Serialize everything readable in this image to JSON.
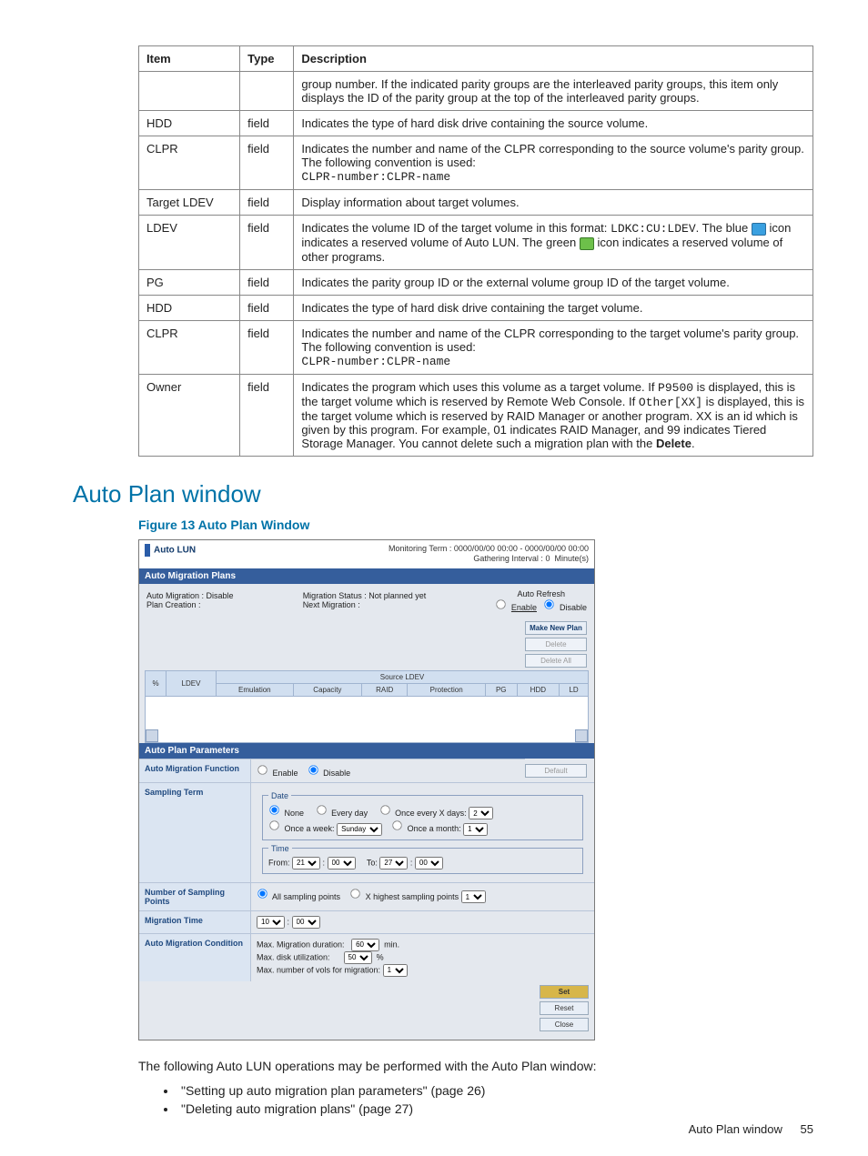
{
  "table": {
    "headers": {
      "item": "Item",
      "type": "Type",
      "desc": "Description"
    },
    "rows": [
      {
        "item": "",
        "type": "",
        "desc_html": "group number. If the indicated parity groups are the interleaved parity groups, this item only displays the ID of the parity group at the top of the interleaved parity groups."
      },
      {
        "item": "HDD",
        "type": "field",
        "desc_html": "Indicates the type of hard disk drive containing the source volume."
      },
      {
        "item": "CLPR",
        "type": "field",
        "desc_html": "Indicates the number and name of the CLPR corresponding to the source volume's parity group. The following convention is used:<br><span class='mono'>CLPR-number:CLPR-name</span>"
      },
      {
        "item": "Target LDEV",
        "type": "field",
        "desc_html": "Display information about target volumes."
      },
      {
        "item": "LDEV",
        "type": "field",
        "desc_html": "Indicates the volume ID of the target volume in this format: <span class='mono'>LDKC:CU:LDEV</span>. The blue <span class='blue-icon' data-name='reserved-autolun-icon' data-interactable='false'></span> icon indicates a reserved volume of Auto LUN. The green <span class='green-icon' data-name='reserved-other-icon' data-interactable='false'></span> icon indicates a reserved volume of other programs."
      },
      {
        "item": "PG",
        "type": "field",
        "desc_html": "Indicates the parity group ID or the external volume group ID of the target volume."
      },
      {
        "item": "HDD",
        "type": "field",
        "desc_html": "Indicates the type of hard disk drive containing the target volume."
      },
      {
        "item": "CLPR",
        "type": "field",
        "desc_html": "Indicates the number and name of the CLPR corresponding to the target volume's parity group. The following convention is used:<br><span class='mono'>CLPR-number:CLPR-name</span>"
      },
      {
        "item": "Owner",
        "type": "field",
        "desc_html": "Indicates the program which uses this volume as a target volume. If <span class='mono'>P9500</span> is displayed, this is the target volume which is reserved by Remote Web Console. If <span class='mono'>Other[XX]</span> is displayed, this is the target volume which is reserved by RAID Manager or another program. XX is an id which is given by this program. For example, 01 indicates RAID Manager, and 99 indicates Tiered Storage Manager. You cannot delete such a migration plan with the <b>Delete</b>."
      }
    ]
  },
  "section_title": "Auto Plan window",
  "figure_caption": "Figure 13 Auto Plan Window",
  "shot": {
    "app_title": "Auto LUN",
    "monitoring_term_label": "Monitoring Term :",
    "monitoring_term_value": "0000/00/00 00:00  -  0000/00/00 00:00",
    "gathering_label": "Gathering Interval :",
    "gathering_value": "0",
    "gathering_unit": "Minute(s)",
    "plans_header": "Auto Migration Plans",
    "auto_migration_label": "Auto Migration :",
    "auto_migration_value": "Disable",
    "plan_creation_label": "Plan Creation :",
    "migration_status_label": "Migration Status :",
    "migration_status_value": "Not planned yet",
    "next_migration_label": "Next Migration :",
    "auto_refresh_label": "Auto Refresh",
    "enable": "Enable",
    "disable": "Disable",
    "source_ldev": "Source LDEV",
    "cols": {
      "pct": "%",
      "ldev": "LDEV",
      "emu": "Emulation",
      "cap": "Capacity",
      "raid": "RAID",
      "prot": "Protection",
      "pg": "PG",
      "hdd": "HDD",
      "ld": "LD"
    },
    "btn_make": "Make New Plan",
    "btn_delete": "Delete",
    "btn_delete_all": "Delete All",
    "params_header": "Auto Plan Parameters",
    "default_btn": "Default",
    "fn_label": "Auto Migration Function",
    "sampling_label": "Sampling Term",
    "date_legend": "Date",
    "none": "None",
    "every_day": "Every day",
    "once_xday": "Once every X days:",
    "once_week": "Once a week:",
    "sunday": "Sunday",
    "once_month": "Once a month:",
    "time_legend": "Time",
    "from": "From:",
    "to": "To:",
    "t_from_h": "21",
    "t_from_m": "00",
    "t_to_h": "27",
    "t_to_m": "00",
    "nsp_label": "Number of Sampling Points",
    "all_sampling": "All sampling points",
    "x_highest": "X highest sampling points",
    "x_val": "1",
    "mig_time_label": "Migration Time",
    "mig_h": "10",
    "mig_m": "00",
    "cond_label": "Auto Migration Condition",
    "max_duration": "Max. Migration duration:",
    "max_duration_v": "60",
    "min_unit": "min.",
    "max_disk": "Max. disk utilization:",
    "max_disk_v": "50",
    "pct_unit": "%",
    "max_vols": "Max. number of vols for migration:",
    "max_vols_v": "1",
    "set": "Set",
    "reset": "Reset",
    "close": "Close"
  },
  "body_after": "The following Auto LUN operations may be performed with the Auto Plan window:",
  "oplist": [
    "\"Setting up auto migration plan parameters\" (page 26)",
    "\"Deleting auto migration plans\" (page 27)"
  ],
  "footer": {
    "text": "Auto Plan window",
    "page": "55"
  }
}
